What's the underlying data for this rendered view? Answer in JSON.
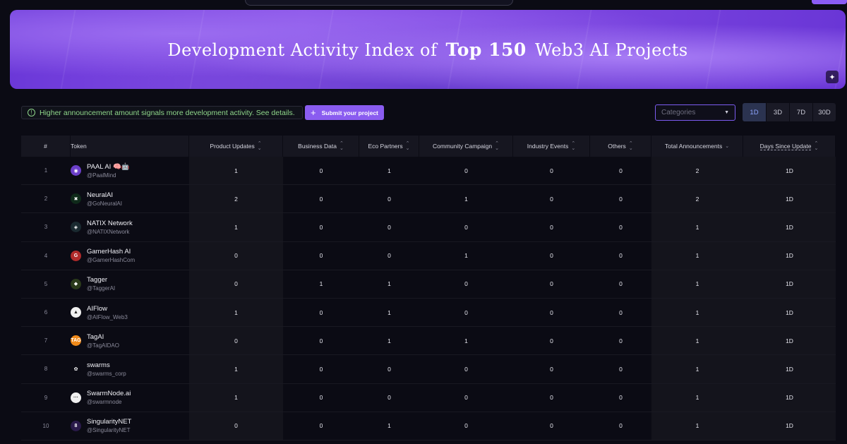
{
  "banner": {
    "title_pre": "Development Activity Index of",
    "title_em": "Top 150",
    "title_post": "Web3 AI Projects",
    "icon": "magic-wand-icon"
  },
  "notice": {
    "text": "Higher announcement amount signals more development activity. See details."
  },
  "submit": {
    "label": "Submit your project"
  },
  "categories": {
    "placeholder": "Categories"
  },
  "ranges": [
    {
      "label": "1D",
      "active": true
    },
    {
      "label": "3D",
      "active": false
    },
    {
      "label": "7D",
      "active": false
    },
    {
      "label": "30D",
      "active": false
    }
  ],
  "headers": {
    "num": "#",
    "token": "Token",
    "product_updates": "Product Updates",
    "business_data": "Business Data",
    "eco_partners": "Eco Partners",
    "community_campaign": "Community Campaign",
    "industry_events": "Industry Events",
    "others": "Others",
    "total": "Total Announcements",
    "days": "Days Since Update"
  },
  "rows": [
    {
      "n": "1",
      "name": "PAAL AI 🧠🤖",
      "handle": "@PaalMind",
      "pu": "1",
      "bd": "0",
      "ep": "1",
      "cc": "0",
      "ie": "0",
      "ot": "0",
      "ta": "2",
      "ds": "1D",
      "logo_color": "#6b3fc9",
      "logo_txt": "◉"
    },
    {
      "n": "2",
      "name": "NeuralAI",
      "handle": "@GoNeuralAI",
      "pu": "2",
      "bd": "0",
      "ep": "0",
      "cc": "1",
      "ie": "0",
      "ot": "0",
      "ta": "2",
      "ds": "1D",
      "logo_color": "#0f2a1a",
      "logo_txt": "✖"
    },
    {
      "n": "3",
      "name": "NATIX Network",
      "handle": "@NATIXNetwork",
      "pu": "1",
      "bd": "0",
      "ep": "0",
      "cc": "0",
      "ie": "0",
      "ot": "0",
      "ta": "1",
      "ds": "1D",
      "logo_color": "#1a2a30",
      "logo_txt": "◈"
    },
    {
      "n": "4",
      "name": "GamerHash AI",
      "handle": "@GamerHashCom",
      "pu": "0",
      "bd": "0",
      "ep": "0",
      "cc": "1",
      "ie": "0",
      "ot": "0",
      "ta": "1",
      "ds": "1D",
      "logo_color": "#b02a2a",
      "logo_txt": "G"
    },
    {
      "n": "5",
      "name": "Tagger",
      "handle": "@TaggerAI",
      "pu": "0",
      "bd": "1",
      "ep": "1",
      "cc": "0",
      "ie": "0",
      "ot": "0",
      "ta": "1",
      "ds": "1D",
      "logo_color": "#2a3a1a",
      "logo_txt": "◆"
    },
    {
      "n": "6",
      "name": "AIFlow",
      "handle": "@AIFlow_Web3",
      "pu": "1",
      "bd": "0",
      "ep": "1",
      "cc": "0",
      "ie": "0",
      "ot": "0",
      "ta": "1",
      "ds": "1D",
      "logo_color": "#f0f0f0",
      "logo_txt": "▲"
    },
    {
      "n": "7",
      "name": "TagAI",
      "handle": "@TagAIDAO",
      "pu": "0",
      "bd": "0",
      "ep": "1",
      "cc": "1",
      "ie": "0",
      "ot": "0",
      "ta": "1",
      "ds": "1D",
      "logo_color": "#f08a1a",
      "logo_txt": "TAG"
    },
    {
      "n": "8",
      "name": "swarms",
      "handle": "@swarms_corp",
      "pu": "1",
      "bd": "0",
      "ep": "0",
      "cc": "0",
      "ie": "0",
      "ot": "0",
      "ta": "1",
      "ds": "1D",
      "logo_color": "#0b0b14",
      "logo_txt": "✿"
    },
    {
      "n": "9",
      "name": "SwarmNode.ai",
      "handle": "@swarmnode",
      "pu": "1",
      "bd": "0",
      "ep": "0",
      "cc": "0",
      "ie": "0",
      "ot": "0",
      "ta": "1",
      "ds": "1D",
      "logo_color": "#f0f0f0",
      "logo_txt": "···"
    },
    {
      "n": "10",
      "name": "SingularityNET",
      "handle": "@SingularityNET",
      "pu": "0",
      "bd": "0",
      "ep": "1",
      "cc": "0",
      "ie": "0",
      "ot": "0",
      "ta": "1",
      "ds": "1D",
      "logo_color": "#2a1a4a",
      "logo_txt": "8"
    }
  ]
}
